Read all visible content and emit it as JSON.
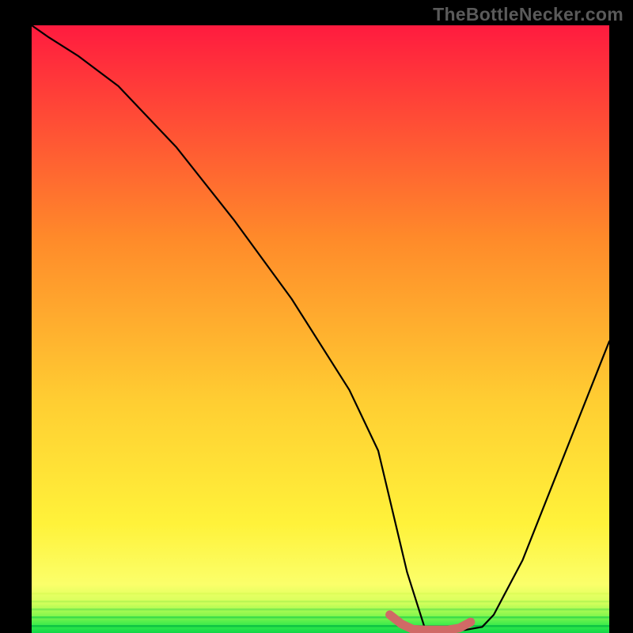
{
  "watermark": "TheBottleNecker.com",
  "chart_data": {
    "type": "line",
    "title": "",
    "xlabel": "",
    "ylabel": "",
    "xlim": [
      0,
      100
    ],
    "ylim": [
      0,
      100
    ],
    "series": [
      {
        "name": "bottleneck-curve",
        "x": [
          0,
          3,
          8,
          15,
          25,
          35,
          45,
          55,
          60,
          62,
          65,
          68,
          70,
          72,
          75,
          78,
          80,
          85,
          90,
          95,
          100
        ],
        "values": [
          100,
          98,
          95,
          90,
          80,
          68,
          55,
          40,
          30,
          22,
          10,
          1,
          0.5,
          0.5,
          0.5,
          1,
          3,
          12,
          24,
          36,
          48
        ]
      }
    ],
    "highlight": {
      "name": "recommended-band",
      "x": [
        62,
        64,
        66,
        68,
        70,
        72,
        74,
        76
      ],
      "values": [
        3.0,
        1.5,
        0.6,
        0.5,
        0.5,
        0.5,
        0.8,
        1.8
      ]
    },
    "gradient_colors": {
      "top": "#ff1b3f",
      "mid_upper": "#ff9a2a",
      "mid_lower": "#ffe93a",
      "bottom": "#19e04a"
    }
  }
}
